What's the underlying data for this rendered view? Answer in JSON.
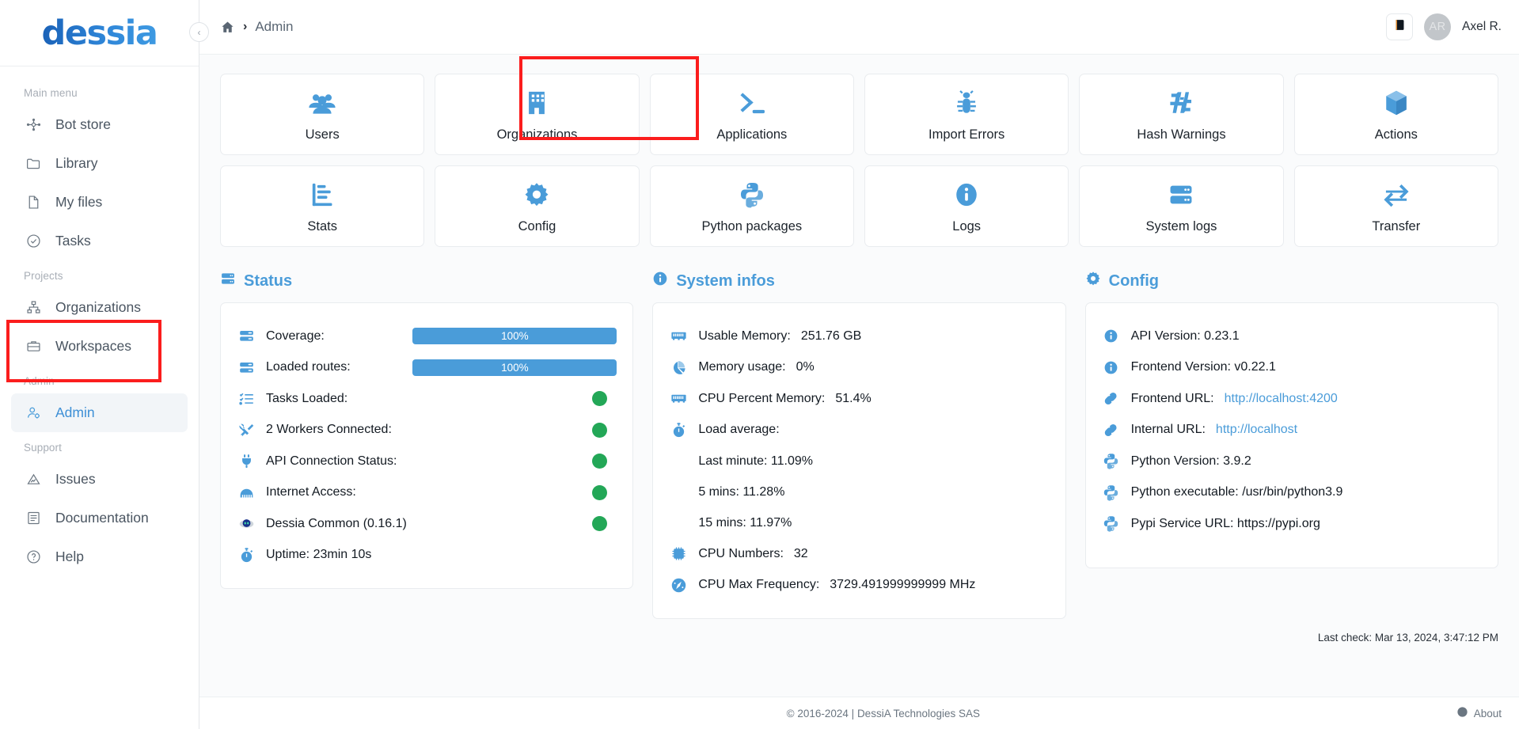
{
  "brand": {
    "logo_text": "dessia"
  },
  "sidebar": {
    "groups": [
      {
        "title": "Main menu",
        "items": [
          {
            "label": "Bot store",
            "icon": "bot-store-icon",
            "active": false
          },
          {
            "label": "Library",
            "icon": "folder-icon",
            "active": false
          },
          {
            "label": "My files",
            "icon": "file-icon",
            "active": false
          },
          {
            "label": "Tasks",
            "icon": "check-circle-icon",
            "active": false
          }
        ]
      },
      {
        "title": "Projects",
        "items": [
          {
            "label": "Organizations",
            "icon": "sitemap-icon",
            "active": false
          },
          {
            "label": "Workspaces",
            "icon": "briefcase-icon",
            "active": false
          }
        ]
      },
      {
        "title": "Admin",
        "items": [
          {
            "label": "Admin",
            "icon": "user-gear-icon",
            "active": true
          }
        ]
      },
      {
        "title": "Support",
        "items": [
          {
            "label": "Issues",
            "icon": "warning-triangle-icon",
            "active": false
          },
          {
            "label": "Documentation",
            "icon": "document-icon",
            "active": false
          },
          {
            "label": "Help",
            "icon": "question-circle-icon",
            "active": false
          }
        ]
      }
    ]
  },
  "topbar": {
    "breadcrumb_home_icon": "home-icon",
    "breadcrumb_separator": "›",
    "breadcrumb_current": "Admin",
    "doc_button_icon": "book-icon",
    "avatar_initials": "AR",
    "user_name": "Axel R."
  },
  "tiles": [
    {
      "label": "Users",
      "icon": "users-icon"
    },
    {
      "label": "Organizations",
      "icon": "building-icon"
    },
    {
      "label": "Applications",
      "icon": "terminal-icon"
    },
    {
      "label": "Import Errors",
      "icon": "bug-icon"
    },
    {
      "label": "Hash Warnings",
      "icon": "hash-icon"
    },
    {
      "label": "Actions",
      "icon": "cube-icon"
    },
    {
      "label": "Stats",
      "icon": "bar-chart-icon"
    },
    {
      "label": "Config",
      "icon": "gear-icon"
    },
    {
      "label": "Python packages",
      "icon": "python-icon"
    },
    {
      "label": "Logs",
      "icon": "info-circle-icon"
    },
    {
      "label": "System logs",
      "icon": "server-icon"
    },
    {
      "label": "Transfer",
      "icon": "transfer-icon"
    }
  ],
  "status_panel": {
    "title": "Status",
    "title_icon": "server-icon",
    "rows": [
      {
        "label": "Coverage:",
        "icon": "server-icon",
        "type": "bar",
        "value": "100%"
      },
      {
        "label": "Loaded routes:",
        "icon": "server-icon",
        "type": "bar",
        "value": "100%"
      },
      {
        "label": "Tasks Loaded:",
        "icon": "tasklist-icon",
        "type": "dot",
        "value": "ok"
      },
      {
        "label": "2 Workers Connected:",
        "icon": "tools-icon",
        "type": "dot",
        "value": "ok"
      },
      {
        "label": "API Connection Status:",
        "icon": "plug-icon",
        "type": "dot",
        "value": "ok"
      },
      {
        "label": "Internet Access:",
        "icon": "network-icon",
        "type": "dot",
        "value": "ok"
      },
      {
        "label": "Dessia Common (0.16.1)",
        "icon": "robot-icon",
        "type": "dot",
        "value": "ok"
      },
      {
        "label": "Uptime: 23min 10s",
        "icon": "stopwatch-icon",
        "type": "none",
        "value": ""
      }
    ]
  },
  "system_panel": {
    "title": "System infos",
    "title_icon": "info-circle-icon",
    "rows": [
      {
        "label": "Usable Memory:",
        "icon": "memory-icon",
        "value": "251.76 GB"
      },
      {
        "label": "Memory usage:",
        "icon": "pie-chart-icon",
        "value": "0%"
      },
      {
        "label": "CPU Percent Memory:",
        "icon": "memory-icon",
        "value": "51.4%"
      },
      {
        "label": "Load average:",
        "icon": "stopwatch-icon",
        "value": ""
      }
    ],
    "load_average": [
      "Last minute: 11.09%",
      "5 mins: 11.28%",
      "15 mins: 11.97%"
    ],
    "rows2": [
      {
        "label": "CPU Numbers:",
        "icon": "cpu-icon",
        "value": "32"
      },
      {
        "label": "CPU Max Frequency:",
        "icon": "gauge-icon",
        "value": "3729.491999999999 MHz"
      }
    ]
  },
  "config_panel": {
    "title": "Config",
    "title_icon": "gear-icon",
    "rows": [
      {
        "label": "API Version: 0.23.1",
        "icon": "info-circle-icon",
        "link": ""
      },
      {
        "label": "Frontend Version: v0.22.1",
        "icon": "info-circle-icon",
        "link": ""
      },
      {
        "label": "Frontend URL:",
        "icon": "link-icon",
        "link": "http://localhost:4200"
      },
      {
        "label": "Internal URL:",
        "icon": "link-icon",
        "link": "http://localhost"
      },
      {
        "label": "Python Version: 3.9.2",
        "icon": "python-icon",
        "link": ""
      },
      {
        "label": "Python executable: /usr/bin/python3.9",
        "icon": "python-icon",
        "link": ""
      },
      {
        "label": "Pypi Service URL: https://pypi.org",
        "icon": "python-icon",
        "link": ""
      }
    ]
  },
  "last_check": "Last check: Mar 13, 2024, 3:47:12 PM",
  "footer": {
    "copyright": "© 2016-2024 | DessiA Technologies SAS",
    "about_label": "About",
    "about_icon": "info-circle-icon"
  },
  "colors": {
    "accent_blue": "#4a9cd9",
    "logo_blue": "#2476c8",
    "status_green": "#23a757",
    "annotation_red": "#fb1d1d"
  }
}
